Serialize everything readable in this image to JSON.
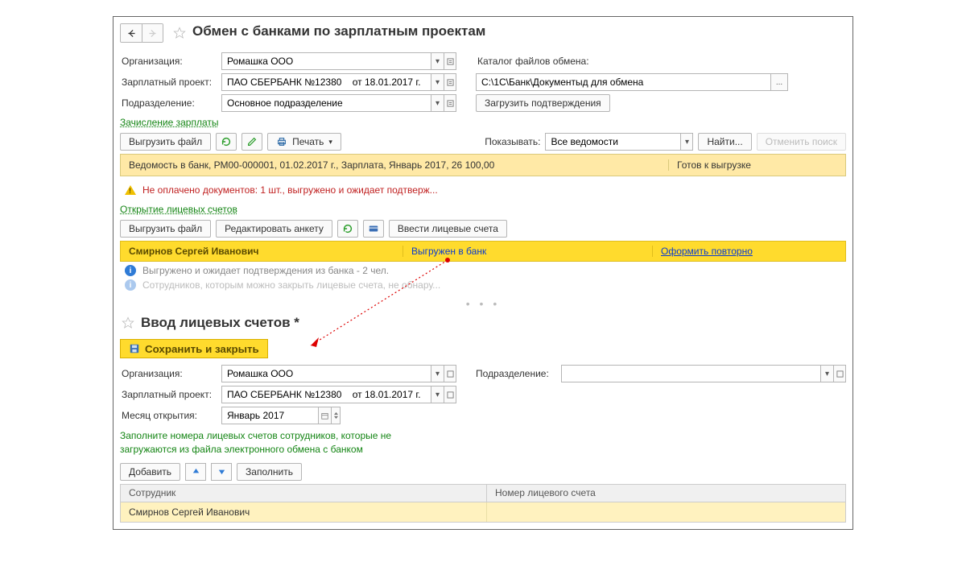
{
  "title": "Обмен с банками по зарплатным проектам",
  "fields": {
    "org_label": "Организация:",
    "org_value": "Ромашка ООО",
    "proj_label": "Зарплатный проект:",
    "proj_value": "ПАО СБЕРБАНК №12380    от 18.01.2017 г.",
    "dept_label": "Подразделение:",
    "dept_value": "Основное подразделение",
    "folder_label": "Каталог файлов обмена:",
    "folder_value": "С:\\1С\\Банк\\Документыд для обмена",
    "load_confirm_btn": "Загрузить подтверждения"
  },
  "section1": {
    "link": "Зачисление зарплаты",
    "export_btn": "Выгрузить файл",
    "print_btn": "Печать",
    "show_label": "Показывать:",
    "show_value": "Все ведомости",
    "find_btn": "Найти...",
    "cancel_find_btn": "Отменить поиск",
    "statement_text": "Ведомость в банк, РМ00-000001, 01.02.2017 г., Зарплата, Январь 2017, 26 100,00",
    "statement_status": "Готов к выгрузке",
    "warning_text": "Не оплачено документов: 1 шт., выгружено и ожидает подтверж..."
  },
  "section2": {
    "link": "Открытие лицевых счетов",
    "export_btn": "Выгрузить файл",
    "edit_btn": "Редактировать анкету",
    "enter_btn": "Ввести лицевые счета",
    "row_name": "Смирнов Сергей Иванович",
    "row_status": "Выгружен в банк",
    "row_action": "Оформить повторно",
    "info1": "Выгружено и ожидает подтверждения из банка - 2 чел.",
    "info2": "Сотрудников, которым можно закрыть лицевые счета, не обнару..."
  },
  "pane2": {
    "title": "Ввод лицевых счетов *",
    "save_btn": "Сохранить и закрыть",
    "org_label": "Организация:",
    "org_value": "Ромашка ООО",
    "dept_label": "Подразделение:",
    "dept_value": "",
    "proj_label": "Зарплатный проект:",
    "proj_value": "ПАО СБЕРБАНК №12380    от 18.01.2017 г.",
    "month_label": "Месяц открытия:",
    "month_value": "Январь 2017",
    "hint1": "Заполните номера лицевых счетов сотрудников, которые не",
    "hint2": "загружаются из файла электронного обмена с банком",
    "add_btn": "Добавить",
    "fill_btn": "Заполнить",
    "th1": "Сотрудник",
    "th2": "Номер лицевого счета",
    "row_name": "Смирнов Сергей Иванович"
  }
}
